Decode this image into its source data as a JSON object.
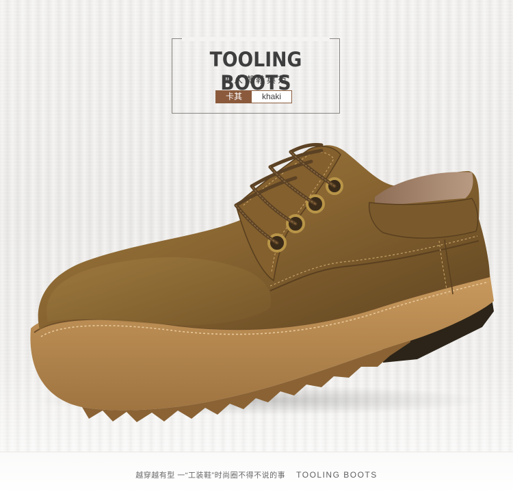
{
  "banner": {
    "title": "TOOLING BOOTS",
    "subtitle": "男人潮鞋典范",
    "color_label_cn": "卡其",
    "color_label_en": "khaki"
  },
  "footer": {
    "tagline_cn": "越穿越有型 一“工装鞋”时尚圈不得不说的事",
    "tagline_en": "TOOLING BOOTS"
  },
  "colors": {
    "leather": "#7a5a2c",
    "sole": "#b78a52",
    "tag": "#8b5a3c",
    "title_text": "#3e3e3e"
  }
}
